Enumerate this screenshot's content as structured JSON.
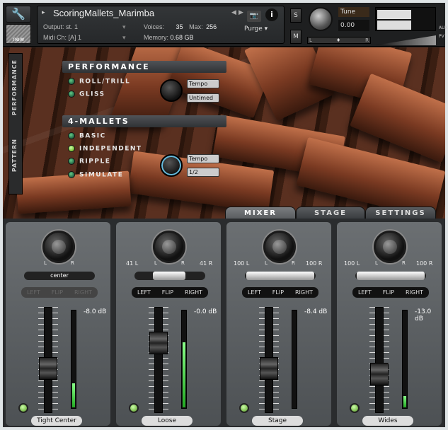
{
  "header": {
    "instrument_name": "ScoringMallets_Marimba",
    "output_label": "Output:",
    "output_value": "st. 1",
    "midi_label": "Midi Ch:",
    "midi_value": "[A] 1",
    "voices_label": "Voices:",
    "voices_value": "35",
    "max_label": "Max:",
    "max_value": "256",
    "memory_label": "Memory:",
    "memory_value": "0.68 GB",
    "purge_label": "Purge",
    "new_label": "new",
    "solo_label": "S",
    "mute_label": "M",
    "tune_label": "Tune",
    "tune_value": "0.00",
    "pan_l": "L",
    "pan_r": "R",
    "aux_label": "AUX",
    "pv_label": "PV"
  },
  "side_tabs": [
    "PERFORMANCE",
    "PATTERN"
  ],
  "performance": {
    "title": "PERFORMANCE",
    "options": [
      "ROLL/TRILL",
      "GLISS"
    ],
    "tempo_label": "Tempo",
    "tempo_mode": "Untimed"
  },
  "mallets": {
    "title": "4-MALLETS",
    "options": [
      "BASIC",
      "INDEPENDENT",
      "RIPPLE",
      "SIMULATE"
    ],
    "selected": "INDEPENDENT",
    "tempo_label": "Tempo",
    "tempo_value": "1/2"
  },
  "tabs": [
    {
      "label": "MIXER",
      "active": true
    },
    {
      "label": "STAGE",
      "active": false
    },
    {
      "label": "SETTINGS",
      "active": false
    }
  ],
  "channels": [
    {
      "name": "Tight Center",
      "width_left": "",
      "width_right": "",
      "width_display": "center",
      "db": "-8.0 dB",
      "fader_level": 0.4,
      "meter_level": 0.25,
      "flip_enabled": false
    },
    {
      "name": "Loose",
      "width_left": "41 L",
      "width_right": "41 R",
      "width_display": "",
      "db": "-0.0 dB",
      "fader_level": 0.7,
      "meter_level": 0.68,
      "flip_enabled": true
    },
    {
      "name": "Stage",
      "width_left": "100 L",
      "width_right": "100 R",
      "width_display": "",
      "db": "-8.4 dB",
      "fader_level": 0.4,
      "meter_level": 0.0,
      "flip_enabled": true
    },
    {
      "name": "Wides",
      "width_left": "100 L",
      "width_right": "100 R",
      "width_display": "",
      "db": "-13.0 dB",
      "fader_level": 0.33,
      "meter_level": 0.12,
      "flip_enabled": true
    }
  ],
  "flip_labels": [
    "LEFT",
    "FLIP",
    "RIGHT"
  ],
  "knob_labels": {
    "l": "L",
    "r": "R"
  }
}
